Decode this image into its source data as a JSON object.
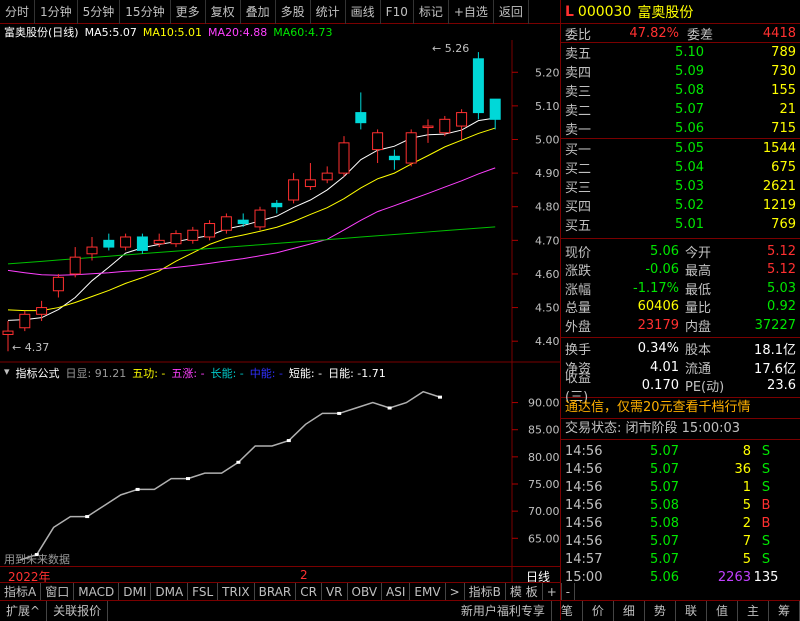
{
  "toolbar": {
    "items": [
      "分时",
      "1分钟",
      "5分钟",
      "15分钟",
      "更多",
      "复权",
      "叠加",
      "多股",
      "统计",
      "画线",
      "F10",
      "标记",
      "+自选",
      "返回"
    ]
  },
  "header": {
    "stock_name": "富奥股份(日线)",
    "ma5_label": "MA5:",
    "ma5": "5.07",
    "ma10_label": "MA10:",
    "ma10": "5.01",
    "ma20_label": "MA20:",
    "ma20": "4.88",
    "ma60_label": "MA60:",
    "ma60": "4.73"
  },
  "price_axis": [
    "5.20",
    "5.10",
    "5.00",
    "4.90",
    "4.80",
    "4.70",
    "4.60",
    "4.50",
    "4.40"
  ],
  "annotations": {
    "high": "5.26",
    "low": "4.37"
  },
  "indicator": {
    "name": "指标公式",
    "rixian": "日显: 91.21",
    "wugong": "五功: -",
    "wuzhang": "五涨: -",
    "changneng": "长能: -",
    "zhongneng": "中能: -",
    "duanneng": "短能: -",
    "rineng": "日能: -1.71",
    "axis": [
      "90.00",
      "85.00",
      "80.00",
      "75.00",
      "70.00",
      "65.00"
    ],
    "watermark": "用到未来数据"
  },
  "date_row": {
    "year": "2022年",
    "month": "2",
    "period": "日线"
  },
  "bottom_tabs": [
    "指标A",
    "窗口",
    "MACD",
    "DMI",
    "DMA",
    "FSL",
    "TRIX",
    "BRAR",
    "CR",
    "VR",
    "OBV",
    "ASI",
    "EMV",
    ">",
    "指标B",
    "模 板",
    "+",
    "-"
  ],
  "footer": {
    "left": [
      "扩展^",
      "关联报价"
    ],
    "promo": "新用户福利专享",
    "tabs": [
      "笔",
      "价",
      "细",
      "势",
      "联",
      "值",
      "主",
      "筹"
    ]
  },
  "quote": {
    "code_prefix": "L",
    "code": "000030",
    "name": "富奥股份",
    "weibi_label": "委比",
    "weibi": "47.82%",
    "weicha_label": "委差",
    "weicha": "4418",
    "asks": [
      {
        "label": "卖五",
        "price": "5.10",
        "vol": "789"
      },
      {
        "label": "卖四",
        "price": "5.09",
        "vol": "730"
      },
      {
        "label": "卖三",
        "price": "5.08",
        "vol": "155"
      },
      {
        "label": "卖二",
        "price": "5.07",
        "vol": "21"
      },
      {
        "label": "卖一",
        "price": "5.06",
        "vol": "715"
      }
    ],
    "bids": [
      {
        "label": "买一",
        "price": "5.05",
        "vol": "1544"
      },
      {
        "label": "买二",
        "price": "5.04",
        "vol": "675"
      },
      {
        "label": "买三",
        "price": "5.03",
        "vol": "2621"
      },
      {
        "label": "买四",
        "price": "5.02",
        "vol": "1219"
      },
      {
        "label": "买五",
        "price": "5.01",
        "vol": "769"
      }
    ],
    "stats": [
      {
        "k": "现价",
        "v": "5.06",
        "vc": "green",
        "k2": "今开",
        "v2": "5.12",
        "v2c": "red"
      },
      {
        "k": "涨跌",
        "v": "-0.06",
        "vc": "green",
        "k2": "最高",
        "v2": "5.12",
        "v2c": "red"
      },
      {
        "k": "涨幅",
        "v": "-1.17%",
        "vc": "green",
        "k2": "最低",
        "v2": "5.03",
        "v2c": "green"
      },
      {
        "k": "总量",
        "v": "60406",
        "vc": "yellow",
        "k2": "量比",
        "v2": "0.92",
        "v2c": "green"
      },
      {
        "k": "外盘",
        "v": "23179",
        "vc": "red",
        "k2": "内盘",
        "v2": "37227",
        "v2c": "green"
      }
    ],
    "stats2": [
      {
        "k": "换手",
        "v": "0.34%",
        "k2": "股本",
        "v2": "18.1亿"
      },
      {
        "k": "净资",
        "v": "4.01",
        "k2": "流通",
        "v2": "17.6亿"
      },
      {
        "k": "收益(三)",
        "v": "0.170",
        "k2": "PE(动)",
        "v2": "23.6"
      }
    ],
    "ad": "通达信，仅需20元查看千档行情",
    "trade_status": "交易状态: 闭市阶段 15:00:03",
    "ticks": [
      {
        "t": "14:56",
        "p": "5.07",
        "q": "8",
        "s": "S"
      },
      {
        "t": "14:56",
        "p": "5.07",
        "q": "36",
        "s": "S"
      },
      {
        "t": "14:56",
        "p": "5.07",
        "q": "1",
        "s": "S"
      },
      {
        "t": "14:56",
        "p": "5.08",
        "q": "5",
        "s": "B"
      },
      {
        "t": "14:56",
        "p": "5.08",
        "q": "2",
        "s": "B"
      },
      {
        "t": "14:56",
        "p": "5.07",
        "q": "7",
        "s": "S"
      },
      {
        "t": "14:57",
        "p": "5.07",
        "q": "5",
        "s": "S"
      },
      {
        "t": "15:00",
        "p": "5.06",
        "q": "2263",
        "s": "135"
      }
    ]
  },
  "candles": [
    {
      "o": 4.42,
      "c": 4.43,
      "h": 4.46,
      "l": 4.37
    },
    {
      "o": 4.44,
      "c": 4.48,
      "h": 4.49,
      "l": 4.43
    },
    {
      "o": 4.48,
      "c": 4.5,
      "h": 4.52,
      "l": 4.46
    },
    {
      "o": 4.55,
      "c": 4.59,
      "h": 4.6,
      "l": 4.53
    },
    {
      "o": 4.6,
      "c": 4.65,
      "h": 4.68,
      "l": 4.59
    },
    {
      "o": 4.66,
      "c": 4.68,
      "h": 4.71,
      "l": 4.64
    },
    {
      "o": 4.7,
      "c": 4.68,
      "h": 4.72,
      "l": 4.67
    },
    {
      "o": 4.68,
      "c": 4.71,
      "h": 4.72,
      "l": 4.67
    },
    {
      "o": 4.71,
      "c": 4.67,
      "h": 4.72,
      "l": 4.66
    },
    {
      "o": 4.69,
      "c": 4.7,
      "h": 4.72,
      "l": 4.68
    },
    {
      "o": 4.69,
      "c": 4.72,
      "h": 4.73,
      "l": 4.68
    },
    {
      "o": 4.7,
      "c": 4.73,
      "h": 4.74,
      "l": 4.69
    },
    {
      "o": 4.71,
      "c": 4.75,
      "h": 4.76,
      "l": 4.7
    },
    {
      "o": 4.73,
      "c": 4.77,
      "h": 4.78,
      "l": 4.72
    },
    {
      "o": 4.76,
      "c": 4.75,
      "h": 4.78,
      "l": 4.74
    },
    {
      "o": 4.74,
      "c": 4.79,
      "h": 4.8,
      "l": 4.73
    },
    {
      "o": 4.81,
      "c": 4.8,
      "h": 4.82,
      "l": 4.78
    },
    {
      "o": 4.82,
      "c": 4.88,
      "h": 4.9,
      "l": 4.81
    },
    {
      "o": 4.86,
      "c": 4.88,
      "h": 4.93,
      "l": 4.85
    },
    {
      "o": 4.88,
      "c": 4.9,
      "h": 4.92,
      "l": 4.87
    },
    {
      "o": 4.9,
      "c": 4.99,
      "h": 5.01,
      "l": 4.89
    },
    {
      "o": 5.08,
      "c": 5.05,
      "h": 5.14,
      "l": 5.03
    },
    {
      "o": 4.97,
      "c": 5.02,
      "h": 5.03,
      "l": 4.93
    },
    {
      "o": 4.95,
      "c": 4.94,
      "h": 4.97,
      "l": 4.91
    },
    {
      "o": 4.93,
      "c": 5.02,
      "h": 5.03,
      "l": 4.92
    },
    {
      "o": 5.04,
      "c": 5.04,
      "h": 5.06,
      "l": 4.99
    },
    {
      "o": 5.02,
      "c": 5.06,
      "h": 5.07,
      "l": 5.01
    },
    {
      "o": 5.04,
      "c": 5.08,
      "h": 5.09,
      "l": 5.0
    },
    {
      "o": 5.24,
      "c": 5.08,
      "h": 5.26,
      "l": 5.06
    },
    {
      "o": 5.12,
      "c": 5.06,
      "h": 5.12,
      "l": 5.03
    }
  ],
  "ind_line": [
    61,
    62,
    67,
    69,
    69,
    71,
    73,
    74,
    74,
    76,
    76,
    77,
    77,
    79,
    82,
    82,
    83,
    86,
    88,
    88,
    89,
    90,
    89,
    90,
    92,
    91
  ],
  "colors": {
    "up": "#ff3030",
    "down": "#00d8d8",
    "ma5": "#ffffff",
    "ma10": "#ffff00",
    "ma20": "#ff40ff",
    "ma60": "#00c000"
  }
}
